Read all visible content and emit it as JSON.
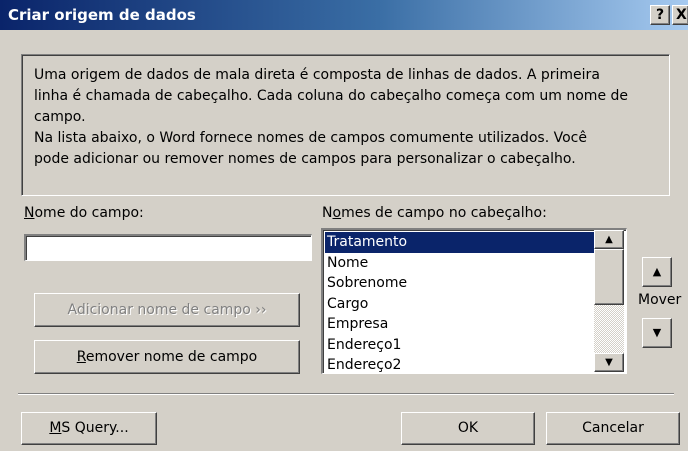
{
  "window": {
    "title": "Criar origem de dados",
    "help_label": "?",
    "close_label": "X"
  },
  "info": {
    "line1": "Uma origem de dados de mala direta é composta de linhas de dados. A primeira",
    "line2": "linha é chamada de cabeçalho. Cada coluna do cabeçalho começa com um nome de",
    "line3": "campo.",
    "line4": "Na lista abaixo, o Word fornece nomes de campos comumente utilizados. Você",
    "line5": "pode adicionar ou remover nomes de campos para personalizar o cabeçalho."
  },
  "field_name": {
    "label_mnemonic": "N",
    "label_rest": "ome do campo:",
    "value": ""
  },
  "header_fields": {
    "label_before": "N",
    "label_mnemonic": "o",
    "label_after": "mes de campo no cabeçalho:",
    "items": [
      "Tratamento",
      "Nome",
      "Sobrenome",
      "Cargo",
      "Empresa",
      "Endereço1",
      "Endereço2"
    ],
    "selected": "Tratamento"
  },
  "buttons": {
    "add": "Adicionar nome de campo ››",
    "remove_mnemonic": "R",
    "remove_rest": "emover nome de campo",
    "move_label": "Mover",
    "ms_query_mnemonic": "M",
    "ms_query_rest": "S Query...",
    "ok": "OK",
    "cancel": "Cancelar"
  },
  "icons": {
    "scroll_up": "▲",
    "scroll_down": "▼",
    "move_up": "▲",
    "move_down": "▼"
  }
}
